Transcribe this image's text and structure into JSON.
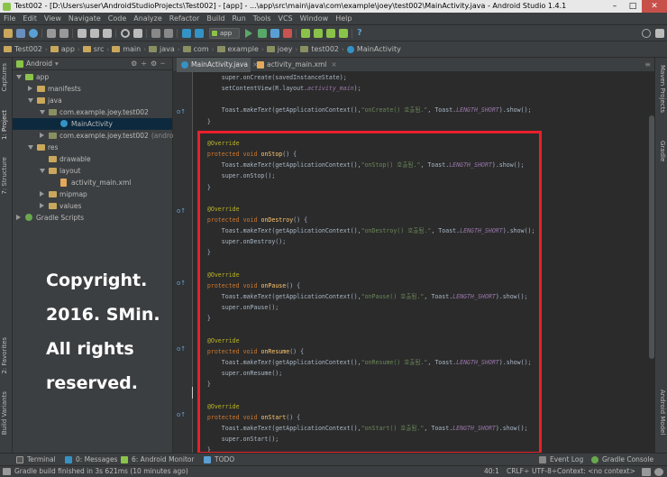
{
  "window": {
    "title": "Test002 - [D:\\Users\\user\\AndroidStudioProjects\\Test002] - [app] - ...\\app\\src\\main\\java\\com\\example\\joey\\test002\\MainActivity.java - Android Studio 1.4.1"
  },
  "menu": [
    "File",
    "Edit",
    "View",
    "Navigate",
    "Code",
    "Analyze",
    "Refactor",
    "Build",
    "Run",
    "Tools",
    "VCS",
    "Window",
    "Help"
  ],
  "toolbar": {
    "config": "app"
  },
  "breadcrumbs": [
    "Test002",
    "app",
    "src",
    "main",
    "java",
    "com",
    "example",
    "joey",
    "test002",
    "MainActivity"
  ],
  "project_panel": {
    "view_mode": "Android",
    "tree": [
      {
        "label": "app",
        "level": 0,
        "open": true,
        "icon": "module"
      },
      {
        "label": "manifests",
        "level": 1,
        "open": false,
        "icon": "folder"
      },
      {
        "label": "java",
        "level": 1,
        "open": true,
        "icon": "folder"
      },
      {
        "label": "com.example.joey.test002",
        "level": 2,
        "open": true,
        "icon": "package"
      },
      {
        "label": "MainActivity",
        "level": 3,
        "icon": "class",
        "selected": true
      },
      {
        "label": "com.example.joey.test002",
        "extra": "(androidT",
        "level": 2,
        "open": false,
        "icon": "package"
      },
      {
        "label": "res",
        "level": 1,
        "open": true,
        "icon": "folder"
      },
      {
        "label": "drawable",
        "level": 2,
        "icon": "folder"
      },
      {
        "label": "layout",
        "level": 2,
        "open": true,
        "icon": "folder"
      },
      {
        "label": "activity_main.xml",
        "level": 3,
        "icon": "xml"
      },
      {
        "label": "mipmap",
        "level": 2,
        "open": false,
        "icon": "folder"
      },
      {
        "label": "values",
        "level": 2,
        "open": false,
        "icon": "folder"
      },
      {
        "label": "Gradle Scripts",
        "level": 0,
        "open": false,
        "icon": "gradle"
      }
    ]
  },
  "copyright": [
    "Copyright.",
    "2016. SMin.",
    "All rights",
    "reserved."
  ],
  "left_tool_tabs": {
    "captures": "Captures",
    "project": "1: Project",
    "structure": "7: Structure",
    "favorites": "2: Favorites",
    "build_variants": "Build Variants"
  },
  "right_tool_tabs": {
    "maven": "Maven Projects",
    "gradle": "Gradle",
    "android_model": "Android Model"
  },
  "editor_tabs": [
    {
      "label": "MainActivity.java",
      "active": true
    },
    {
      "label": "activity_main.xml",
      "active": false
    }
  ],
  "code_lines": [
    [
      [
        "",
        "        super.onCreate(savedInstanceState);"
      ]
    ],
    [
      [
        "",
        "        setContentView(R.layout."
      ],
      [
        "fld",
        "activity_main"
      ],
      [
        "",
        ");"
      ]
    ],
    [
      [
        "",
        ""
      ]
    ],
    [
      [
        "",
        "        Toast."
      ],
      [
        "it",
        "makeText"
      ],
      [
        "",
        "(getApplicationContext(),"
      ],
      [
        "st",
        "\"onCreate() 호출됨.\""
      ],
      [
        "",
        ", Toast."
      ],
      [
        "fld",
        "LENGTH_SHORT"
      ],
      [
        "",
        ").show();"
      ]
    ],
    [
      [
        "",
        "    }"
      ]
    ],
    [
      [
        "",
        ""
      ]
    ],
    [
      [
        "an",
        "    @Override"
      ]
    ],
    [
      [
        "kw",
        "    protected void "
      ],
      [
        "fn",
        "onStop"
      ],
      [
        "",
        "() {"
      ]
    ],
    [
      [
        "",
        "        Toast."
      ],
      [
        "it",
        "makeText"
      ],
      [
        "",
        "(getApplicationContext(),"
      ],
      [
        "st",
        "\"onStop() 호출됨.\""
      ],
      [
        "",
        ", Toast."
      ],
      [
        "fld",
        "LENGTH_SHORT"
      ],
      [
        "",
        ").show();"
      ]
    ],
    [
      [
        "",
        "        super.onStop();"
      ]
    ],
    [
      [
        "",
        "    }"
      ]
    ],
    [
      [
        "",
        ""
      ]
    ],
    [
      [
        "an",
        "    @Override"
      ]
    ],
    [
      [
        "kw",
        "    protected void "
      ],
      [
        "fn",
        "onDestroy"
      ],
      [
        "",
        "() {"
      ]
    ],
    [
      [
        "",
        "        Toast."
      ],
      [
        "it",
        "makeText"
      ],
      [
        "",
        "(getApplicationContext(),"
      ],
      [
        "st",
        "\"onDestroy() 호출됨.\""
      ],
      [
        "",
        ", Toast."
      ],
      [
        "fld",
        "LENGTH_SHORT"
      ],
      [
        "",
        ").show();"
      ]
    ],
    [
      [
        "",
        "        super.onDestroy();"
      ]
    ],
    [
      [
        "",
        "    }"
      ]
    ],
    [
      [
        "",
        ""
      ]
    ],
    [
      [
        "an",
        "    @Override"
      ]
    ],
    [
      [
        "kw",
        "    protected void "
      ],
      [
        "fn",
        "onPause"
      ],
      [
        "",
        "() {"
      ]
    ],
    [
      [
        "",
        "        Toast."
      ],
      [
        "it",
        "makeText"
      ],
      [
        "",
        "(getApplicationContext(),"
      ],
      [
        "st",
        "\"onPause() 호출됨.\""
      ],
      [
        "",
        ", Toast."
      ],
      [
        "fld",
        "LENGTH_SHORT"
      ],
      [
        "",
        ").show();"
      ]
    ],
    [
      [
        "",
        "        super.onPause();"
      ]
    ],
    [
      [
        "",
        "    }"
      ]
    ],
    [
      [
        "",
        ""
      ]
    ],
    [
      [
        "an",
        "    @Override"
      ]
    ],
    [
      [
        "kw",
        "    protected void "
      ],
      [
        "fn",
        "onResume"
      ],
      [
        "",
        "() {"
      ]
    ],
    [
      [
        "",
        "        Toast."
      ],
      [
        "it",
        "makeText"
      ],
      [
        "",
        "(getApplicationContext(),"
      ],
      [
        "st",
        "\"onResume() 호출됨.\""
      ],
      [
        "",
        ", Toast."
      ],
      [
        "fld",
        "LENGTH_SHORT"
      ],
      [
        "",
        ").show();"
      ]
    ],
    [
      [
        "",
        "        super.onResume();"
      ]
    ],
    [
      [
        "",
        "    }"
      ]
    ],
    [
      [
        "",
        ""
      ]
    ],
    [
      [
        "an",
        "    @Override"
      ]
    ],
    [
      [
        "kw",
        "    protected void "
      ],
      [
        "fn",
        "onStart"
      ],
      [
        "",
        "() {"
      ]
    ],
    [
      [
        "",
        "        Toast."
      ],
      [
        "it",
        "makeText"
      ],
      [
        "",
        "(getApplicationContext(),"
      ],
      [
        "st",
        "\"onStart() 호출됨.\""
      ],
      [
        "",
        ", Toast."
      ],
      [
        "fld",
        "LENGTH_SHORT"
      ],
      [
        "",
        ").show();"
      ]
    ],
    [
      [
        "",
        "        super.onStart();"
      ]
    ],
    [
      [
        "",
        "    }"
      ]
    ]
  ],
  "bottom_tabs": {
    "terminal": "Terminal",
    "messages": "0: Messages",
    "android_monitor": "6: Android Monitor",
    "todo": "TODO",
    "event_log": "Event Log",
    "gradle_console": "Gradle Console"
  },
  "status": {
    "message": "Gradle build finished in 3s 621ms (10 minutes ago)",
    "position": "40:1",
    "line_sep": "CRLF÷",
    "encoding": "UTF-8÷",
    "context": "Context: <no context>"
  },
  "colors": {
    "highlight_box": "#e8202a",
    "selection": "#0d293e",
    "editor_bg": "#2b2b2b"
  }
}
